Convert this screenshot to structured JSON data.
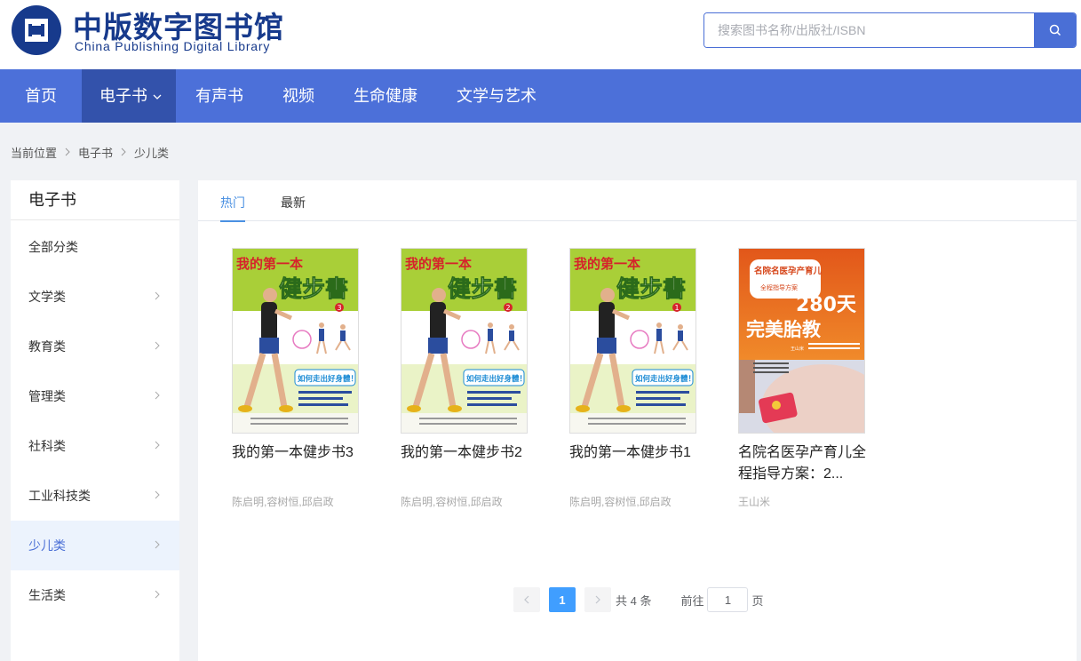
{
  "header": {
    "logo_cn": "中版数字图书馆",
    "logo_en": "China Publishing Digital Library",
    "search_placeholder": "搜索图书名称/出版社/ISBN",
    "brand_color": "#173a8c"
  },
  "nav": {
    "items": [
      "首页",
      "电子书",
      "有声书",
      "视频",
      "生命健康",
      "文学与艺术"
    ],
    "active": "电子书",
    "color": "#4c70d9"
  },
  "breadcrumb": {
    "label": "当前位置",
    "items": [
      "电子书",
      "少儿类"
    ]
  },
  "sidebar": {
    "title": "电子书",
    "items": [
      "全部分类",
      "文学类",
      "教育类",
      "管理类",
      "社科类",
      "工业科技类",
      "少儿类",
      "生活类"
    ],
    "active": "少儿类"
  },
  "tabs": {
    "items": [
      "热门",
      "最新"
    ],
    "active": "热门"
  },
  "books": [
    {
      "title": "我的第一本健步书3",
      "author": "陈启明,容树恒,邱启政",
      "cover": {
        "top_text": "我的第一本",
        "main_text": "健步書",
        "badge": "3",
        "sub_text": "如何走出好身體！",
        "icon": "walking-figure-icon"
      }
    },
    {
      "title": "我的第一本健步书2",
      "author": "陈启明,容树恒,邱启政",
      "cover": {
        "top_text": "我的第一本",
        "main_text": "健步書",
        "badge": "2",
        "sub_text": "如何走出好身體！",
        "icon": "walking-figure-icon"
      }
    },
    {
      "title": "我的第一本健步书1",
      "author": "陈启明,容树恒,邱启政",
      "cover": {
        "top_text": "我的第一本",
        "main_text": "健步書",
        "badge": "1",
        "sub_text": "如何走出好身體！",
        "icon": "walking-figure-icon"
      }
    },
    {
      "title": "名院名医孕产育儿全程指导方案：2...",
      "author": "王山米",
      "cover": {
        "top_text": "名院名医孕产育儿",
        "badge_text": "全程指导方案",
        "main_number": "280天",
        "main_text": "完美胎教",
        "author": "王山米",
        "icon": "pregnant-belly-icon"
      }
    }
  ],
  "pagination": {
    "current": "1",
    "total": "共 4 条",
    "goto_label": "前往",
    "goto_value": "1",
    "page_suffix": "页"
  }
}
